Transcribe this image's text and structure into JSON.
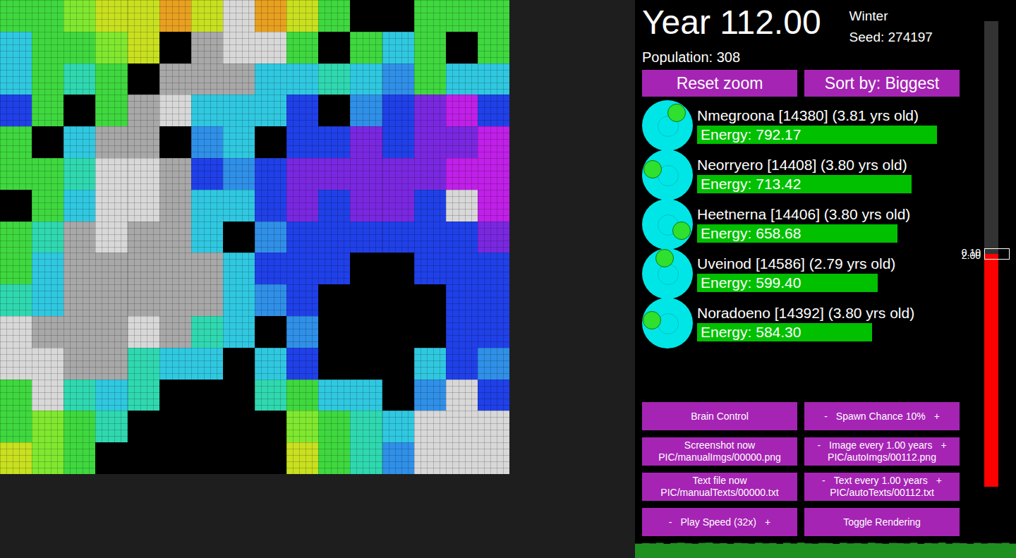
{
  "map": {
    "tiles": [
      [
        "#3fd83f",
        "#3fd83f",
        "#80e830",
        "#c8e020",
        "#c8e020",
        "#e8a020",
        "#c8e020",
        "#d8d8d8",
        "#e8a020",
        "#c8e020",
        "#3fd83f",
        "#000000",
        "#000000",
        "#3fd83f",
        "#3fd83f",
        "#3fd83f"
      ],
      [
        "#30c8e0",
        "#3fd83f",
        "#3fd83f",
        "#80e830",
        "#c8e020",
        "#000000",
        "#a8a8a8",
        "#d8d8d8",
        "#d8d8d8",
        "#3fd83f",
        "#000000",
        "#3fd83f",
        "#30c8e0",
        "#3fd83f",
        "#000000",
        "#3fd83f"
      ],
      [
        "#30c8e0",
        "#3fd83f",
        "#30d8b0",
        "#3fd83f",
        "#000000",
        "#a8a8a8",
        "#a8a8a8",
        "#a8a8a8",
        "#30c8e0",
        "#30c8e0",
        "#30d8b0",
        "#30c8e0",
        "#3090e8",
        "#3fd83f",
        "#30c8e0",
        "#30c8e0"
      ],
      [
        "#2040e8",
        "#3fd83f",
        "#000000",
        "#3fd83f",
        "#a8a8a8",
        "#d8d8d8",
        "#30c8e0",
        "#30c8e0",
        "#30c8e0",
        "#2040e8",
        "#000000",
        "#3090e8",
        "#2040e8",
        "#7a28e0",
        "#c020e8",
        "#2040e8"
      ],
      [
        "#3fd83f",
        "#000000",
        "#30c8e0",
        "#a8a8a8",
        "#a8a8a8",
        "#000000",
        "#3090e8",
        "#30c8e0",
        "#000000",
        "#2040e8",
        "#2040e8",
        "#7a28e0",
        "#2040e8",
        "#7a28e0",
        "#7a28e0",
        "#c020e8"
      ],
      [
        "#3fd83f",
        "#3fd83f",
        "#30d8b0",
        "#d8d8d8",
        "#d8d8d8",
        "#a8a8a8",
        "#2040e8",
        "#3090e8",
        "#2040e8",
        "#7a28e0",
        "#7a28e0",
        "#7a28e0",
        "#7a28e0",
        "#7a28e0",
        "#c020e8",
        "#c020e8"
      ],
      [
        "#000000",
        "#3fd83f",
        "#30c8e0",
        "#d8d8d8",
        "#d8d8d8",
        "#a8a8a8",
        "#30c8e0",
        "#30c8e0",
        "#2040e8",
        "#7a28e0",
        "#2040e8",
        "#7a28e0",
        "#7a28e0",
        "#2040e8",
        "#d8d8d8",
        "#c020e8"
      ],
      [
        "#3fd83f",
        "#30d8b0",
        "#a8a8a8",
        "#d8d8d8",
        "#a8a8a8",
        "#a8a8a8",
        "#30c8e0",
        "#000000",
        "#3090e8",
        "#2040e8",
        "#2040e8",
        "#2040e8",
        "#2040e8",
        "#2040e8",
        "#2040e8",
        "#7a28e0"
      ],
      [
        "#3fd83f",
        "#30c8e0",
        "#a8a8a8",
        "#a8a8a8",
        "#a8a8a8",
        "#a8a8a8",
        "#a8a8a8",
        "#30c8e0",
        "#2040e8",
        "#2040e8",
        "#2040e8",
        "#000000",
        "#000000",
        "#2040e8",
        "#2040e8",
        "#2040e8"
      ],
      [
        "#30d8b0",
        "#30c8e0",
        "#a8a8a8",
        "#a8a8a8",
        "#a8a8a8",
        "#a8a8a8",
        "#a8a8a8",
        "#30c8e0",
        "#3090e8",
        "#2040e8",
        "#000000",
        "#000000",
        "#000000",
        "#000000",
        "#2040e8",
        "#2040e8"
      ],
      [
        "#d8d8d8",
        "#a8a8a8",
        "#a8a8a8",
        "#a8a8a8",
        "#d8d8d8",
        "#a8a8a8",
        "#30d8b0",
        "#30c8e0",
        "#000000",
        "#3090e8",
        "#000000",
        "#000000",
        "#000000",
        "#000000",
        "#2040e8",
        "#2040e8"
      ],
      [
        "#d8d8d8",
        "#d8d8d8",
        "#a8a8a8",
        "#a8a8a8",
        "#30d8b0",
        "#30c8e0",
        "#30c8e0",
        "#000000",
        "#30c8e0",
        "#2040e8",
        "#000000",
        "#000000",
        "#000000",
        "#30c8e0",
        "#2040e8",
        "#3090e8"
      ],
      [
        "#3fd83f",
        "#d8d8d8",
        "#30d8b0",
        "#30c8e0",
        "#30d8b0",
        "#000000",
        "#000000",
        "#000000",
        "#30d8b0",
        "#3fd83f",
        "#30c8e0",
        "#30c8e0",
        "#000000",
        "#3090e8",
        "#d8d8d8",
        "#2040e8"
      ],
      [
        "#3fd83f",
        "#80e830",
        "#3fd83f",
        "#30d8b0",
        "#000000",
        "#000000",
        "#000000",
        "#000000",
        "#000000",
        "#80e830",
        "#3fd83f",
        "#30d8b0",
        "#30c8e0",
        "#d8d8d8",
        "#d8d8d8",
        "#d8d8d8"
      ],
      [
        "#c8e020",
        "#80e830",
        "#3fd83f",
        "#000000",
        "#000000",
        "#000000",
        "#000000",
        "#000000",
        "#000000",
        "#c8e020",
        "#3fd83f",
        "#30d8b0",
        "#3090e8",
        "#d8d8d8",
        "#d8d8d8",
        "#d8d8d8"
      ]
    ]
  },
  "header": {
    "year": "Year 112.00",
    "season": "Winter",
    "seed": "Seed: 274197",
    "population": "Population: 308"
  },
  "top_buttons": [
    "Reset zoom",
    "Sort by: Biggest"
  ],
  "creatures": [
    {
      "label": "Nmegroona [14380] (3.81 yrs old)",
      "energy": "Energy: 792.17",
      "level": 0.85,
      "facing": -55
    },
    {
      "label": "Neorryero [14408] (3.80 yrs old)",
      "energy": "Energy: 713.42",
      "level": 0.76,
      "facing": 200
    },
    {
      "label": "Heetnerna [14406] (3.80 yrs old)",
      "energy": "Energy: 658.68",
      "level": 0.71,
      "facing": 25
    },
    {
      "label": "Uveinod [14586] (2.79 yrs old)",
      "energy": "Energy: 599.40",
      "level": 0.64,
      "facing": -100
    },
    {
      "label": "Noradoeno [14392] (3.80 yrs old)",
      "energy": "Energy: 584.30",
      "level": 0.62,
      "facing": 190
    }
  ],
  "controls": [
    {
      "kind": "plain",
      "label": "Brain Control"
    },
    {
      "kind": "stepper",
      "minus": "-",
      "label": "Spawn Chance 10%",
      "plus": "+"
    },
    {
      "kind": "plain",
      "label": "Screenshot now",
      "sub": "PIC/manualImgs/00000.png"
    },
    {
      "kind": "stepper",
      "minus": "-",
      "label": "Image every 1.00 years",
      "plus": "+",
      "sub": "PIC/autoImgs/00112.png"
    },
    {
      "kind": "plain",
      "label": "Text file now",
      "sub": "PIC/manualTexts/00000.txt"
    },
    {
      "kind": "stepper",
      "minus": "-",
      "label": "Text every 1.00 years",
      "plus": "+",
      "sub": "PIC/autoTexts/00112.txt"
    },
    {
      "kind": "stepper",
      "minus": "-",
      "label": "Play Speed (32x)",
      "plus": "+"
    },
    {
      "kind": "plain",
      "label": "Toggle Rendering"
    }
  ],
  "temperature_slider": {
    "level": 0.5,
    "top_label": "0.10",
    "bottom_label": "2.00"
  },
  "population_graph": {
    "values": [
      300,
      310,
      305,
      318,
      296,
      312,
      320,
      308,
      299,
      315,
      322,
      304,
      311,
      298,
      316,
      309,
      301,
      319,
      306,
      313,
      297,
      317,
      303,
      321,
      307,
      300,
      314,
      310,
      296,
      318,
      305,
      312,
      302,
      320,
      308,
      299,
      316,
      311,
      304,
      319,
      297,
      313,
      306,
      322,
      300,
      315,
      309,
      298,
      317,
      303,
      312,
      307,
      318,
      301
    ]
  }
}
